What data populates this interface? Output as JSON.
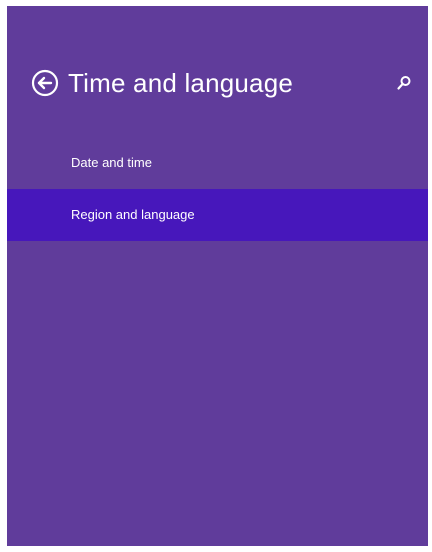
{
  "header": {
    "title": "Time and language",
    "back_icon": "back-arrow-circle-icon",
    "search_icon": "search-icon"
  },
  "nav": {
    "items": [
      {
        "label": "Date and time",
        "selected": false
      },
      {
        "label": "Region and language",
        "selected": true
      }
    ]
  },
  "colors": {
    "background": "#603c9b",
    "selected": "#4717bb",
    "text": "#ffffff"
  }
}
